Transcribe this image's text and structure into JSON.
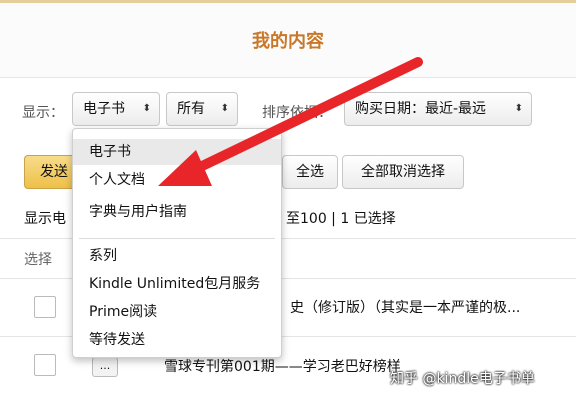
{
  "page": {
    "title": "我的内容"
  },
  "filters": {
    "show_label": "显示：",
    "type_select": "电子书",
    "scope_select": "所有",
    "sort_label": "排序依据：",
    "sort_select": "购买日期：最近-最远"
  },
  "actions": {
    "send_button": "发送",
    "select_all_button": "全选",
    "deselect_all_button": "全部取消选择"
  },
  "summary": {
    "prefix": "显示电",
    "range": "至100 | 1 已选择"
  },
  "table": {
    "select_header": "选择"
  },
  "rows": [
    {
      "more": "...",
      "title": "史（修订版）（其实是一本严谨的极..."
    },
    {
      "more": "...",
      "title": "雪球专刊第001期——学习老巴好榜样"
    }
  ],
  "dropdown": {
    "selected_index": 0,
    "items": [
      "电子书",
      "个人文档",
      "字典与用户指南",
      "系列",
      "Kindle Unlimited包月服务",
      "Prime阅读",
      "等待发送"
    ]
  },
  "watermark": "知乎 @kindle电子书单",
  "colors": {
    "accent": "#c87828",
    "annotation_arrow": "#e8262a",
    "primary_button": "#eec048"
  },
  "icons": {
    "select_caret": "up-down-caret-icon"
  }
}
